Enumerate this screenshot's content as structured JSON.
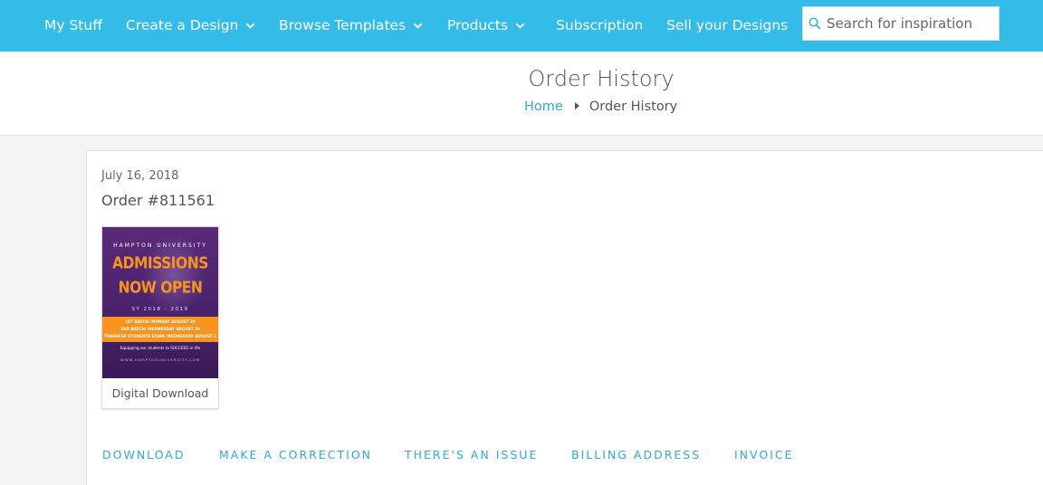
{
  "nav": {
    "items": [
      {
        "label": "My Stuff",
        "dropdown": false
      },
      {
        "label": "Create a Design",
        "dropdown": true
      },
      {
        "label": "Browse Templates",
        "dropdown": true
      },
      {
        "label": "Products",
        "dropdown": true
      },
      {
        "label": "Subscription",
        "dropdown": false
      },
      {
        "label": "Sell your Designs",
        "dropdown": false
      }
    ],
    "search": {
      "placeholder": "Search for inspiration",
      "icon": "search-icon"
    }
  },
  "header": {
    "title": "Order History",
    "breadcrumb": {
      "home": "Home",
      "current": "Order History"
    }
  },
  "order": {
    "date": "July 16, 2018",
    "number": "Order #811561",
    "product": {
      "label": "Digital Download",
      "thumbnail": {
        "university": "HAMPTON UNIVERSITY",
        "headline_1": "ADMISSIONS",
        "headline_2": "NOW OPEN",
        "years": "SY 2018 - 2019",
        "batch_1": "1ST BATCH: MONDAY AUGUST 20",
        "batch_2": "2ND BATCH: WEDNESDAY AUGUST 29",
        "batch_3": "TRANSFER STUDENTS EXAM: WEDNESDAY AUGUST 1",
        "tagline": "Equipping our students to SUCCEED in life",
        "website": "WWW.HAMPTONUNIVERSITY.COM"
      }
    },
    "actions": [
      {
        "label": "DOWNLOAD"
      },
      {
        "label": "MAKE A CORRECTION"
      },
      {
        "label": "THERE'S AN ISSUE"
      },
      {
        "label": "BILLING ADDRESS"
      },
      {
        "label": "INVOICE"
      }
    ]
  },
  "colors": {
    "nav_bg": "#34bce9",
    "link": "#34a8d8",
    "thumb_purple": "#4d2470",
    "thumb_orange": "#f7931e"
  }
}
